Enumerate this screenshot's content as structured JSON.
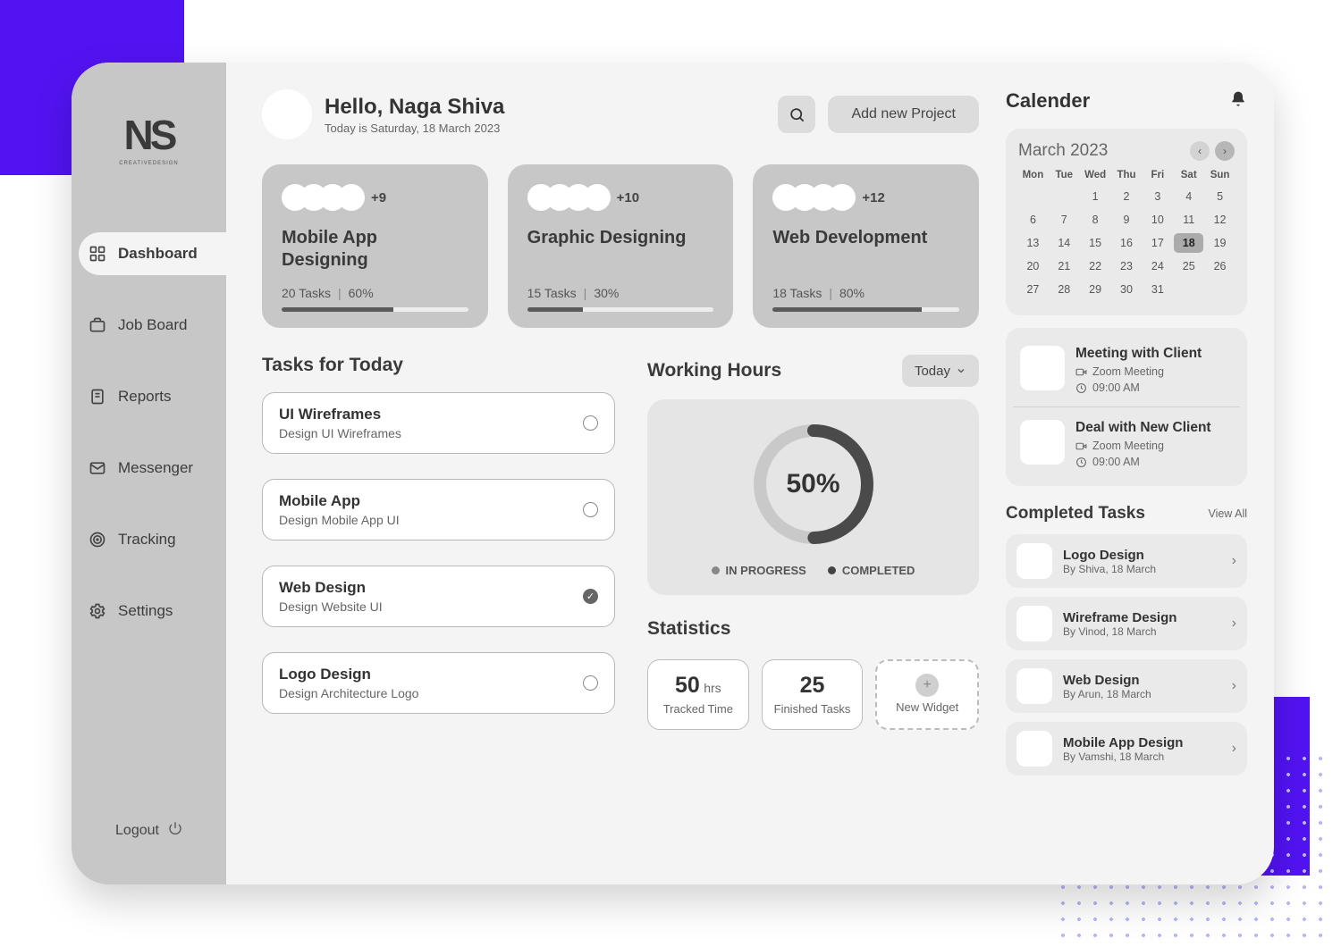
{
  "brand": {
    "name": "NS",
    "sub": "CREATIVEDESIGN",
    "logout": "Logout"
  },
  "nav": [
    {
      "label": "Dashboard",
      "active": true,
      "icon": "grid"
    },
    {
      "label": "Job Board",
      "active": false,
      "icon": "briefcase"
    },
    {
      "label": "Reports",
      "active": false,
      "icon": "report"
    },
    {
      "label": "Messenger",
      "active": false,
      "icon": "mail"
    },
    {
      "label": "Tracking",
      "active": false,
      "icon": "target"
    },
    {
      "label": "Settings",
      "active": false,
      "icon": "gear"
    }
  ],
  "header": {
    "greeting": "Hello, Naga Shiva",
    "date": "Today is Saturday, 18 March 2023",
    "add_project": "Add new Project"
  },
  "projects": [
    {
      "title": "Mobile App Designing",
      "extra": "+9",
      "tasks": "20 Tasks",
      "pct": "60%",
      "pct_n": 60
    },
    {
      "title": "Graphic Designing",
      "extra": "+10",
      "tasks": "15 Tasks",
      "pct": "30%",
      "pct_n": 30
    },
    {
      "title": "Web Development",
      "extra": "+12",
      "tasks": "18 Tasks",
      "pct": "80%",
      "pct_n": 80
    }
  ],
  "tasks_title": "Tasks  for Today",
  "tasks": [
    {
      "title": "UI Wireframes",
      "sub": "Design UI Wireframes",
      "done": false
    },
    {
      "title": "Mobile App",
      "sub": "Design Mobile App UI",
      "done": false
    },
    {
      "title": "Web Design",
      "sub": "Design Website UI",
      "done": true
    },
    {
      "title": "Logo Design",
      "sub": "Design Architecture Logo",
      "done": false
    }
  ],
  "working": {
    "title": "Working Hours",
    "dropdown": "Today",
    "pct": "50%",
    "legend": {
      "a": "IN PROGRESS",
      "b": "COMPLETED"
    }
  },
  "stats": {
    "title": "Statistics",
    "items": [
      {
        "big": "50",
        "unit": "hrs",
        "lbl": "Tracked Time"
      },
      {
        "big": "25",
        "unit": "",
        "lbl": "Finished Tasks"
      }
    ],
    "new": "New Widget"
  },
  "calendar": {
    "title": "Calender",
    "month": "March",
    "year": "2023",
    "dow": [
      "Mon",
      "Tue",
      "Wed",
      "Thu",
      "Fri",
      "Sat",
      "Sun"
    ],
    "offset": 2,
    "days": 31,
    "selected": 18
  },
  "events": [
    {
      "name": "Meeting with Client",
      "meta": "Zoom Meeting",
      "time": "09:00 AM"
    },
    {
      "name": "Deal with New Client",
      "meta": "Zoom Meeting",
      "time": "09:00 AM"
    }
  ],
  "completed": {
    "title": "Completed Tasks",
    "viewall": "View All",
    "items": [
      {
        "name": "Logo Design",
        "by": "By Shiva, 18 March"
      },
      {
        "name": "Wireframe Design",
        "by": "By Vinod, 18 March"
      },
      {
        "name": "Web Design",
        "by": "By Arun, 18 March"
      },
      {
        "name": "Mobile App Design",
        "by": "By Vamshi, 18 March"
      }
    ]
  },
  "chart_data": {
    "type": "pie",
    "title": "Working Hours",
    "series": [
      {
        "name": "IN PROGRESS",
        "value": 50
      },
      {
        "name": "COMPLETED",
        "value": 50
      }
    ],
    "center_label": "50%"
  }
}
